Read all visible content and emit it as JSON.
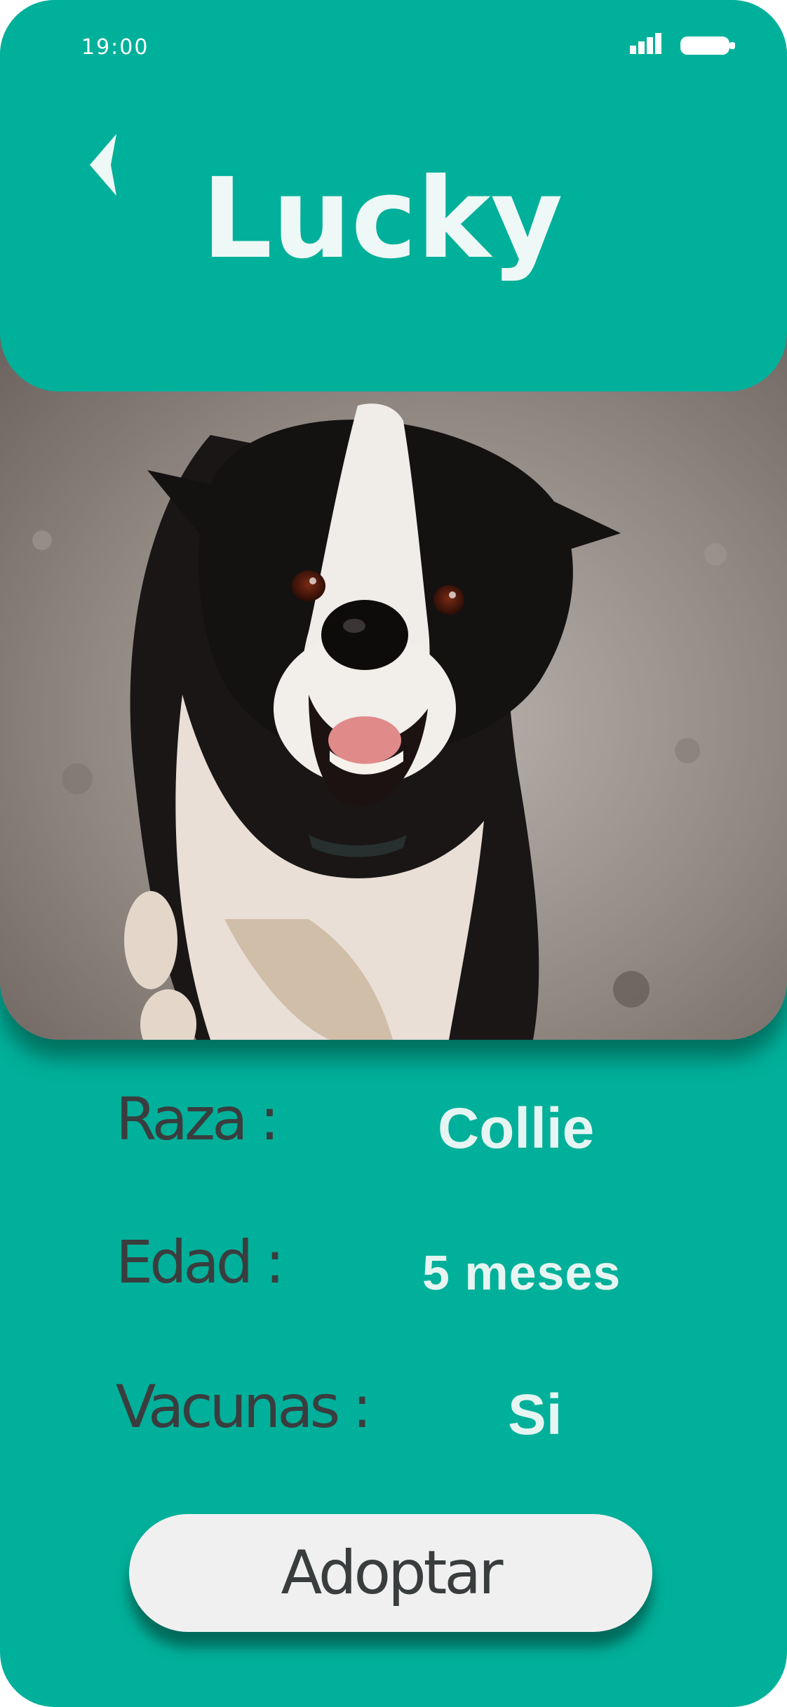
{
  "status_bar": {
    "time": "19:00",
    "signal_icon": "signal-bars-icon",
    "battery_icon": "battery-icon"
  },
  "header": {
    "back_icon": "chevron-left-icon",
    "title": "Lucky"
  },
  "photo": {
    "subject": "dog-photo"
  },
  "details": {
    "breed_label": "Raza :",
    "breed_value": "Collie",
    "age_label": "Edad :",
    "age_value": "5 meses",
    "vaccines_label": "Vacunas :",
    "vaccines_value": "Si"
  },
  "actions": {
    "adopt_label": "Adoptar"
  },
  "colors": {
    "background": "#00b09a",
    "title_text": "#eef8f6",
    "label_text": "#3a3d3e",
    "value_text": "#e6f5f2",
    "button_bg": "#f0f0f0"
  }
}
